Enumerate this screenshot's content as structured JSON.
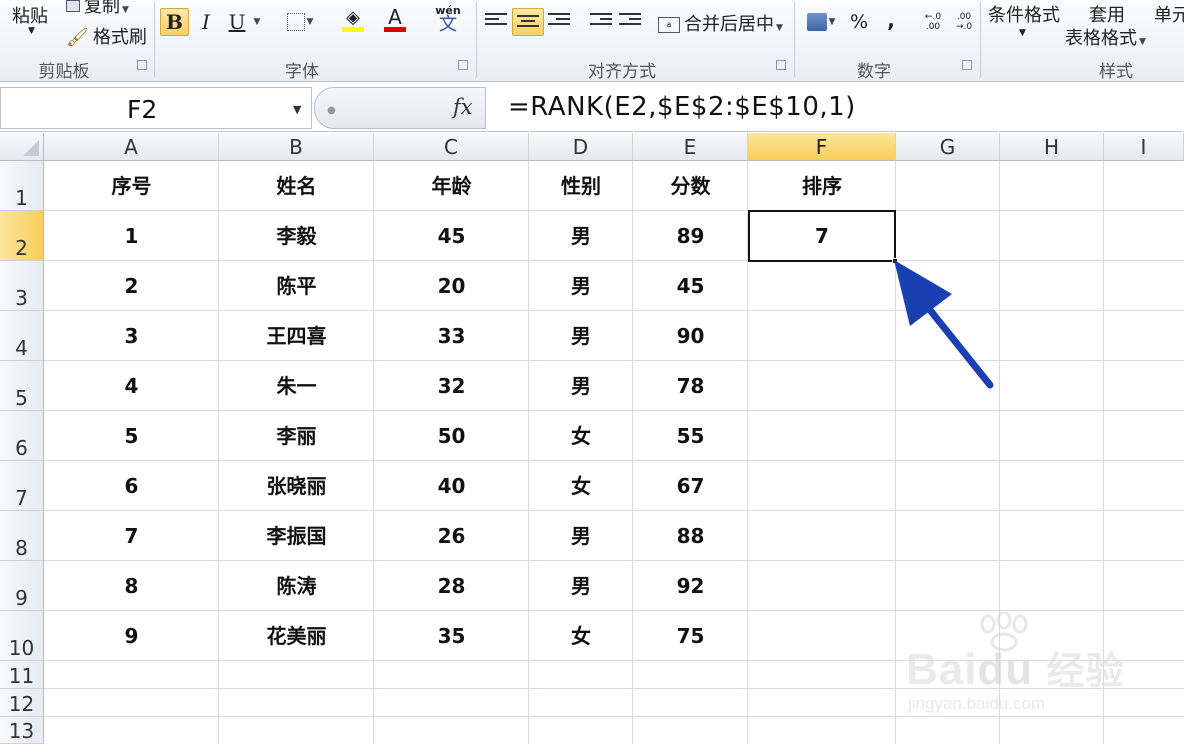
{
  "ribbon": {
    "clipboard": {
      "paste": "粘贴",
      "copy": "复制",
      "format_painter": "格式刷",
      "group": "剪贴板"
    },
    "font": {
      "group": "字体",
      "bold": "B",
      "italic": "I",
      "underline": "U",
      "font_color": "A",
      "phonetic": "wén",
      "phonetic_char": "文"
    },
    "alignment": {
      "group": "对齐方式",
      "merge_center": "合并后居中"
    },
    "number": {
      "group": "数字",
      "percent": "%",
      "comma": ",",
      "inc_decimal": "←.0 .00",
      "dec_decimal": ".00 →.0"
    },
    "styles": {
      "group": "样式",
      "conditional": "条件格式",
      "table_line1": "套用",
      "table_line2": "表格格式",
      "cell_styles": "单元"
    }
  },
  "formula_bar": {
    "name_box": "F2",
    "fx": "fx",
    "formula": "=RANK(E2,$E$2:$E$10,1)"
  },
  "grid": {
    "columns": [
      "A",
      "B",
      "C",
      "D",
      "E",
      "F",
      "G",
      "H",
      "I"
    ],
    "rows": [
      "1",
      "2",
      "3",
      "4",
      "5",
      "6",
      "7",
      "8",
      "9",
      "10",
      "11",
      "12",
      "13"
    ],
    "selected_column": "F",
    "selected_row": "2",
    "header": [
      "序号",
      "姓名",
      "年龄",
      "性别",
      "分数",
      "排序"
    ],
    "data": [
      [
        "1",
        "李毅",
        "45",
        "男",
        "89"
      ],
      [
        "2",
        "陈平",
        "20",
        "男",
        "45"
      ],
      [
        "3",
        "王四喜",
        "33",
        "男",
        "90"
      ],
      [
        "4",
        "朱一",
        "32",
        "男",
        "78"
      ],
      [
        "5",
        "李丽",
        "50",
        "女",
        "55"
      ],
      [
        "6",
        "张晓丽",
        "40",
        "女",
        "67"
      ],
      [
        "7",
        "李振国",
        "26",
        "男",
        "88"
      ],
      [
        "8",
        "陈涛",
        "28",
        "男",
        "92"
      ],
      [
        "9",
        "花美丽",
        "35",
        "女",
        "75"
      ]
    ],
    "active_cell": {
      "ref": "F2",
      "value": "7"
    }
  },
  "colors": {
    "selection_header": "#f7cd5a",
    "arrow": "#1a3fb3",
    "grid_line": "#d6dbe2"
  },
  "watermark": {
    "brand": "Bai",
    "brand_suffix": "du",
    "brand_cn": "经验",
    "url": "jingyan.baidu.com"
  }
}
